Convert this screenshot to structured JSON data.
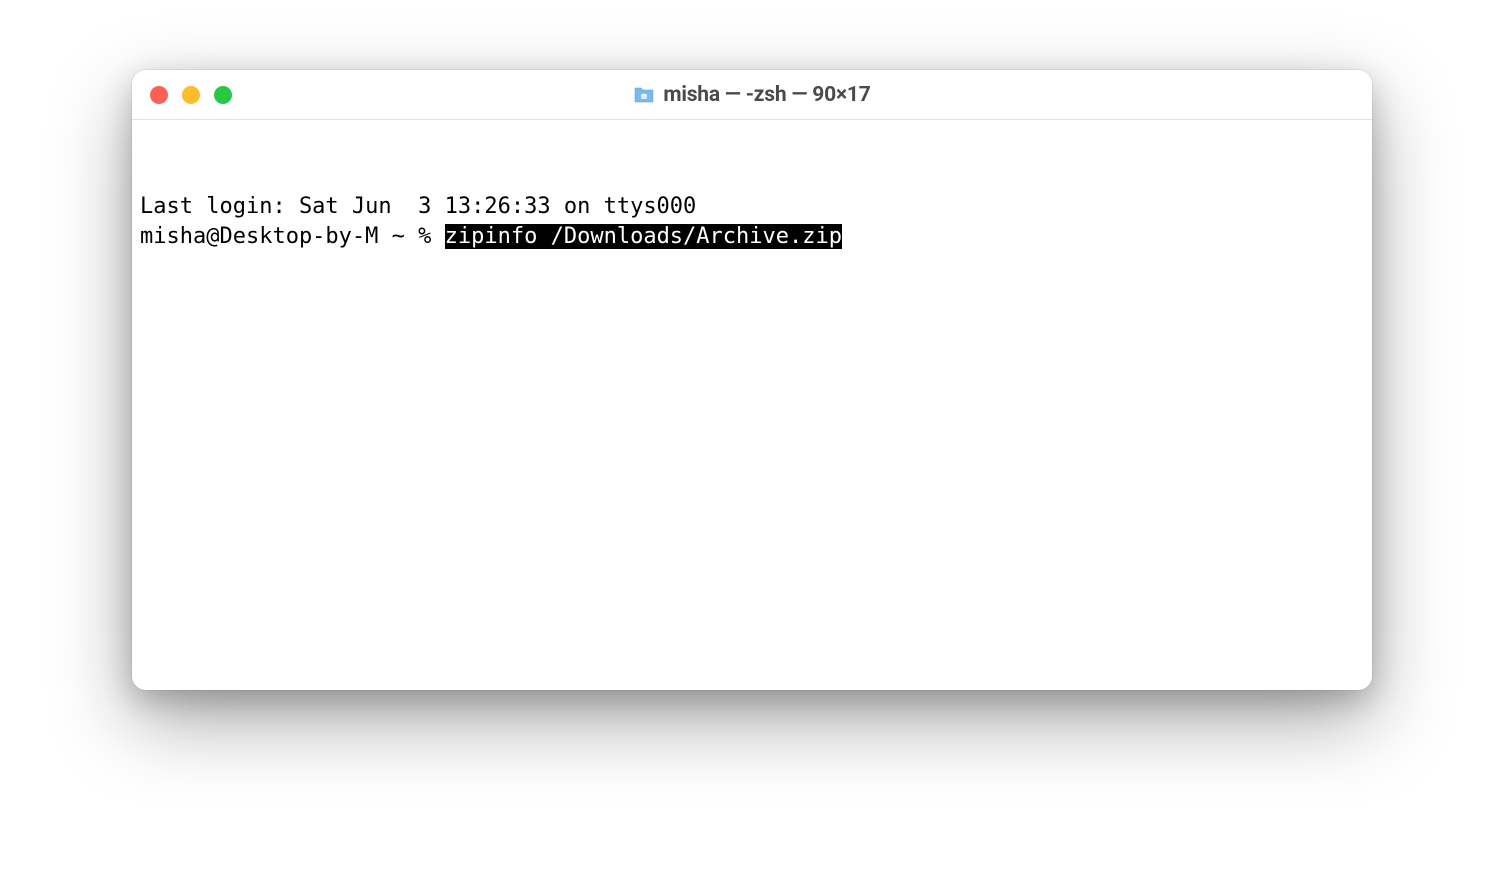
{
  "window": {
    "title": "misha — -zsh — 90×17"
  },
  "terminal": {
    "lastLogin": "Last login: Sat Jun  3 13:26:33 on ttys000",
    "prompt": "misha@Desktop-by-M ~ % ",
    "command": "zipinfo /Downloads/Archive.zip"
  }
}
